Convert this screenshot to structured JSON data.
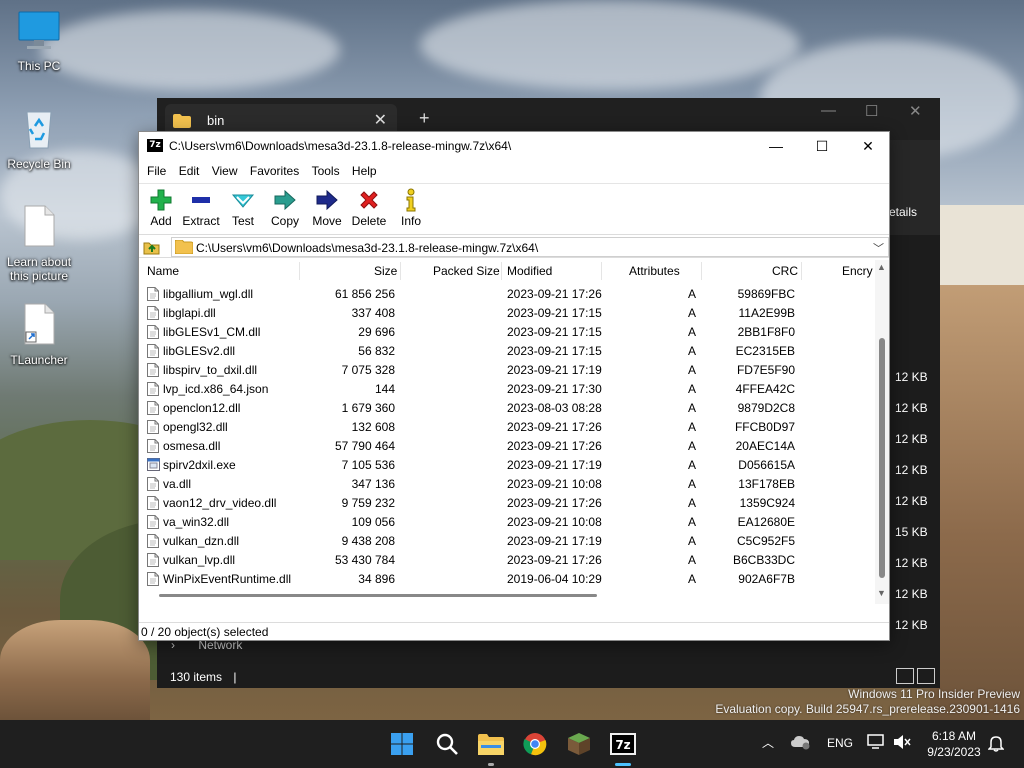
{
  "desktop": {
    "icons": [
      {
        "label": "This PC"
      },
      {
        "label": "Recycle Bin"
      },
      {
        "label": "Learn about this picture"
      },
      {
        "label": "TLauncher"
      }
    ]
  },
  "explorer": {
    "tab_title": "bin",
    "new_tab": "+",
    "close_tab": "✕",
    "details_label": "etails",
    "sizes": [
      "12 KB",
      "12 KB",
      "12 KB",
      "12 KB",
      "12 KB",
      "15 KB",
      "12 KB",
      "12 KB",
      "12 KB"
    ],
    "nav_item": "Network",
    "status": "130 items"
  },
  "sevenzip": {
    "title": "C:\\Users\\vm6\\Downloads\\mesa3d-23.1.8-release-mingw.7z\\x64\\",
    "app_icon_text": "7z",
    "menu": [
      "File",
      "Edit",
      "View",
      "Favorites",
      "Tools",
      "Help"
    ],
    "toolbar": [
      {
        "label": "Add",
        "icon": "plus-icon"
      },
      {
        "label": "Extract",
        "icon": "minus-icon"
      },
      {
        "label": "Test",
        "icon": "check-icon"
      },
      {
        "label": "Copy",
        "icon": "double-arrow-icon"
      },
      {
        "label": "Move",
        "icon": "arrow-icon"
      },
      {
        "label": "Delete",
        "icon": "x-icon"
      },
      {
        "label": "Info",
        "icon": "info-icon"
      }
    ],
    "address": "C:\\Users\\vm6\\Downloads\\mesa3d-23.1.8-release-mingw.7z\\x64\\",
    "columns": {
      "name": "Name",
      "size": "Size",
      "packed": "Packed Size",
      "modified": "Modified",
      "attributes": "Attributes",
      "crc": "CRC",
      "encrypted": "Encry"
    },
    "files": [
      {
        "name": "libgallium_wgl.dll",
        "size": "61 856 256",
        "modified": "2023-09-21 17:26",
        "attr": "A",
        "crc": "59869FBC",
        "type": "dll"
      },
      {
        "name": "libglapi.dll",
        "size": "337 408",
        "modified": "2023-09-21 17:15",
        "attr": "A",
        "crc": "11A2E99B",
        "type": "dll"
      },
      {
        "name": "libGLESv1_CM.dll",
        "size": "29 696",
        "modified": "2023-09-21 17:15",
        "attr": "A",
        "crc": "2BB1F8F0",
        "type": "dll"
      },
      {
        "name": "libGLESv2.dll",
        "size": "56 832",
        "modified": "2023-09-21 17:15",
        "attr": "A",
        "crc": "EC2315EB",
        "type": "dll"
      },
      {
        "name": "libspirv_to_dxil.dll",
        "size": "7 075 328",
        "modified": "2023-09-21 17:19",
        "attr": "A",
        "crc": "FD7E5F90",
        "type": "dll"
      },
      {
        "name": "lvp_icd.x86_64.json",
        "size": "144",
        "modified": "2023-09-21 17:30",
        "attr": "A",
        "crc": "4FFEA42C",
        "type": "file"
      },
      {
        "name": "openclon12.dll",
        "size": "1 679 360",
        "modified": "2023-08-03 08:28",
        "attr": "A",
        "crc": "9879D2C8",
        "type": "dll"
      },
      {
        "name": "opengl32.dll",
        "size": "132 608",
        "modified": "2023-09-21 17:26",
        "attr": "A",
        "crc": "FFCB0D97",
        "type": "dll"
      },
      {
        "name": "osmesa.dll",
        "size": "57 790 464",
        "modified": "2023-09-21 17:26",
        "attr": "A",
        "crc": "20AEC14A",
        "type": "dll"
      },
      {
        "name": "spirv2dxil.exe",
        "size": "7 105 536",
        "modified": "2023-09-21 17:19",
        "attr": "A",
        "crc": "D056615A",
        "type": "exe"
      },
      {
        "name": "va.dll",
        "size": "347 136",
        "modified": "2023-09-21 10:08",
        "attr": "A",
        "crc": "13F178EB",
        "type": "dll"
      },
      {
        "name": "vaon12_drv_video.dll",
        "size": "9 759 232",
        "modified": "2023-09-21 17:26",
        "attr": "A",
        "crc": "1359C924",
        "type": "dll"
      },
      {
        "name": "va_win32.dll",
        "size": "109 056",
        "modified": "2023-09-21 10:08",
        "attr": "A",
        "crc": "EA12680E",
        "type": "dll"
      },
      {
        "name": "vulkan_dzn.dll",
        "size": "9 438 208",
        "modified": "2023-09-21 17:19",
        "attr": "A",
        "crc": "C5C952F5",
        "type": "dll"
      },
      {
        "name": "vulkan_lvp.dll",
        "size": "53 430 784",
        "modified": "2023-09-21 17:26",
        "attr": "A",
        "crc": "B6CB33DC",
        "type": "dll"
      },
      {
        "name": "WinPixEventRuntime.dll",
        "size": "34 896",
        "modified": "2019-06-04 10:29",
        "attr": "A",
        "crc": "902A6F7B",
        "type": "dll"
      }
    ],
    "status": "0 / 20 object(s) selected"
  },
  "watermark": {
    "line1": "Windows 11 Pro Insider Preview",
    "line2": "Evaluation copy. Build 25947.rs_prerelease.230901-1416"
  },
  "taskbar": {
    "language": "ENG",
    "time": "6:18 AM",
    "date": "9/23/2023"
  }
}
